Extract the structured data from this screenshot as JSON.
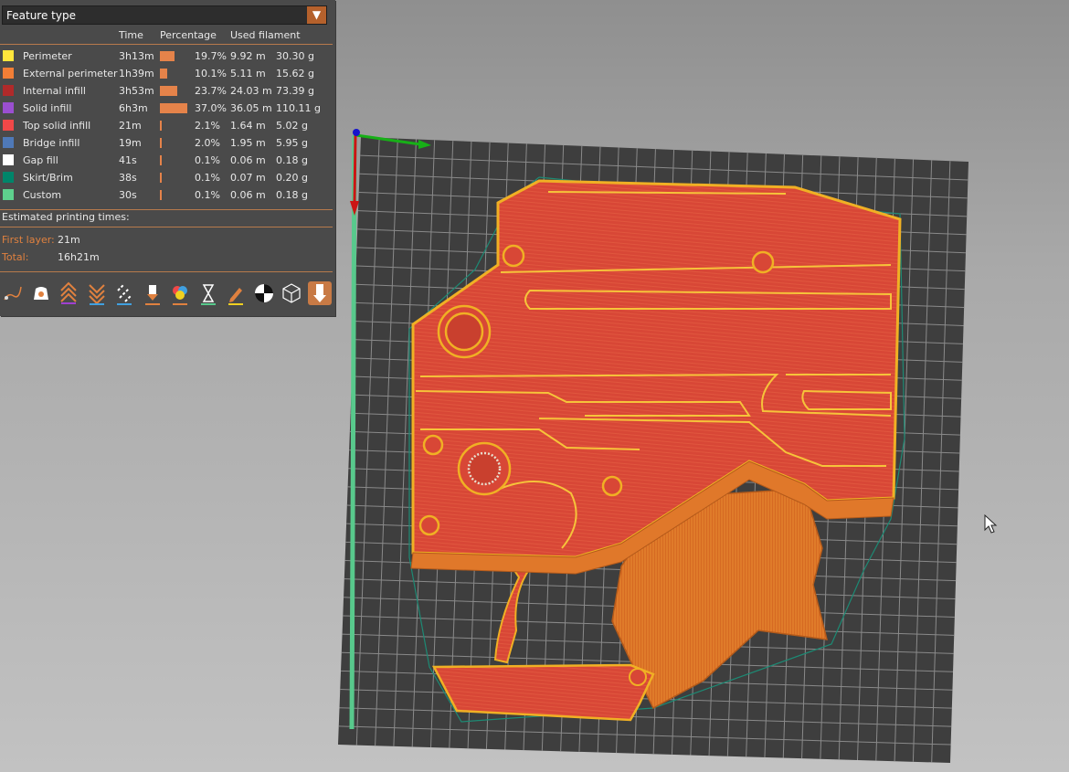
{
  "legend": {
    "selector_value": "Feature type",
    "columns": [
      "Time",
      "Percentage",
      "Used filament"
    ],
    "rows": [
      {
        "name": "Perimeter",
        "color": "#ffe63c",
        "time": "3h13m",
        "percent": "19.7%",
        "pct_value": 19.7,
        "length": "9.92 m",
        "weight": "30.30 g"
      },
      {
        "name": "External perimeter",
        "color": "#f27e36",
        "time": "1h39m",
        "percent": "10.1%",
        "pct_value": 10.1,
        "length": "5.11 m",
        "weight": "15.62 g"
      },
      {
        "name": "Internal infill",
        "color": "#b02a2a",
        "time": "3h53m",
        "percent": "23.7%",
        "pct_value": 23.7,
        "length": "24.03 m",
        "weight": "73.39 g"
      },
      {
        "name": "Solid infill",
        "color": "#9a4fd0",
        "time": "6h3m",
        "percent": "37.0%",
        "pct_value": 37.0,
        "length": "36.05 m",
        "weight": "110.11 g"
      },
      {
        "name": "Top solid infill",
        "color": "#f04848",
        "time": "21m",
        "percent": "2.1%",
        "pct_value": 2.1,
        "length": "1.64 m",
        "weight": "5.02 g"
      },
      {
        "name": "Bridge infill",
        "color": "#4f79b8",
        "time": "19m",
        "percent": "2.0%",
        "pct_value": 2.0,
        "length": "1.95 m",
        "weight": "5.95 g"
      },
      {
        "name": "Gap fill",
        "color": "#ffffff",
        "time": "41s",
        "percent": "0.1%",
        "pct_value": 0.1,
        "length": "0.06 m",
        "weight": "0.18 g"
      },
      {
        "name": "Skirt/Brim",
        "color": "#00856a",
        "time": "38s",
        "percent": "0.1%",
        "pct_value": 0.1,
        "length": "0.07 m",
        "weight": "0.20 g"
      },
      {
        "name": "Custom",
        "color": "#5ed08d",
        "time": "30s",
        "percent": "0.1%",
        "pct_value": 0.1,
        "length": "0.06 m",
        "weight": "0.18 g"
      }
    ],
    "estimated_title": "Estimated printing times:",
    "first_layer_label": "First layer:",
    "first_layer_value": "21m",
    "total_label": "Total:",
    "total_value": "16h21m",
    "toolbar_icons": [
      "travel-icon",
      "wipe-icon",
      "retractions-icon",
      "deretractions-icon",
      "seams-icon",
      "tool-changes-icon",
      "color-changes-icon",
      "pause-prints-icon",
      "custom-gcode-icon",
      "center-of-gravity-icon",
      "shells-icon",
      "tool-marker-icon"
    ],
    "active_toolbar_icon": "tool-marker-icon"
  },
  "colors": {
    "panel_bg": "#4a4a4a",
    "accent": "#e0813f",
    "bed": "#3d3d3d",
    "model_fill": "#d94a36",
    "model_edge": "#f0b024",
    "model_orange": "#e0782a"
  }
}
